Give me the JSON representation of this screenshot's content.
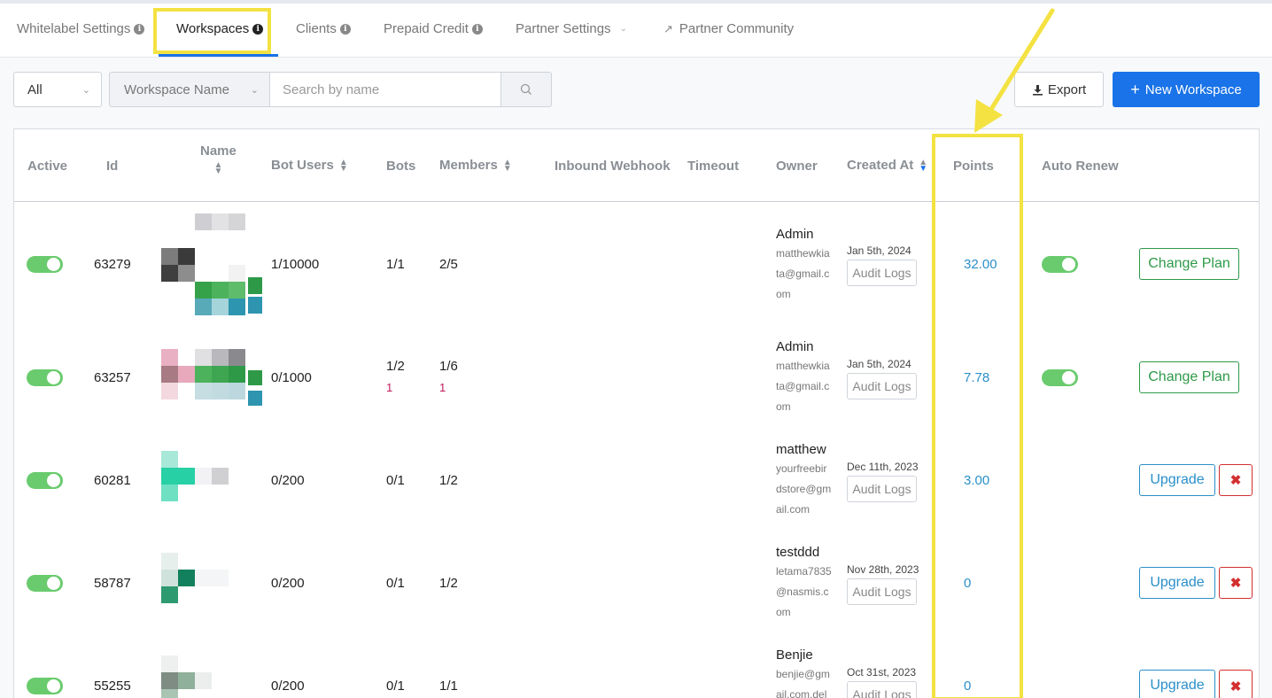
{
  "tabs": [
    {
      "label": "Whitelabel Settings",
      "info": true
    },
    {
      "label": "Workspaces",
      "info": true
    },
    {
      "label": "Clients",
      "info": true
    },
    {
      "label": "Prepaid Credit",
      "info": true
    },
    {
      "label": "Partner Settings",
      "dropdown": true
    },
    {
      "label": "Partner Community",
      "external": true
    }
  ],
  "filters": {
    "status": "All",
    "field": "Workspace Name",
    "search_placeholder": "Search by name"
  },
  "actions": {
    "export_label": "Export",
    "new_label": "New Workspace"
  },
  "columns": {
    "active": "Active",
    "id": "Id",
    "name": "Name",
    "bot_users": "Bot Users",
    "bots": "Bots",
    "members": "Members",
    "inbound": "Inbound Webhook",
    "timeout": "Timeout",
    "owner": "Owner",
    "created_at": "Created At",
    "points": "Points",
    "auto_renew": "Auto Renew"
  },
  "rows": [
    {
      "active": true,
      "id": "63279",
      "bot_users": "1/10000",
      "bots": "1/1",
      "bots_sub": "",
      "members": "2/5",
      "members_sub": "",
      "owner_name": "Admin",
      "owner_email": "matthewkiata@gmail.com",
      "created": "Jan 5th, 2024",
      "audit": "Audit Logs",
      "points": "32.00",
      "auto_renew": true,
      "action": "Change Plan"
    },
    {
      "active": true,
      "id": "63257",
      "bot_users": "0/1000",
      "bots": "1/2",
      "bots_sub": "1",
      "members": "1/6",
      "members_sub": "1",
      "owner_name": "Admin",
      "owner_email": "matthewkiata@gmail.com",
      "created": "Jan 5th, 2024",
      "audit": "Audit Logs",
      "points": "7.78",
      "auto_renew": true,
      "action": "Change Plan"
    },
    {
      "active": true,
      "id": "60281",
      "bot_users": "0/200",
      "bots": "0/1",
      "bots_sub": "",
      "members": "1/2",
      "members_sub": "",
      "owner_name": "matthew",
      "owner_email": "yourfreebirdstore@gmail.com",
      "created": "Dec 11th, 2023",
      "audit": "Audit Logs",
      "points": "3.00",
      "auto_renew": false,
      "action": "Upgrade"
    },
    {
      "active": true,
      "id": "58787",
      "bot_users": "0/200",
      "bots": "0/1",
      "bots_sub": "",
      "members": "1/2",
      "members_sub": "",
      "owner_name": "testddd",
      "owner_email": "letama7835@nasmis.com",
      "created": "Nov 28th, 2023",
      "audit": "Audit Logs",
      "points": "0",
      "auto_renew": false,
      "action": "Upgrade"
    },
    {
      "active": true,
      "id": "55255",
      "bot_users": "0/200",
      "bots": "0/1",
      "bots_sub": "",
      "members": "1/1",
      "members_sub": "",
      "owner_name": "Benjie",
      "owner_email": "benjie@gmail.com.del",
      "created": "Oct 31st, 2023",
      "audit": "Audit Logs",
      "points": "0",
      "auto_renew": false,
      "action": "Upgrade"
    }
  ],
  "colors": {
    "accent": "#1a73e8",
    "toggle_on": "#6acb6e",
    "points": "#2a8fc9",
    "change_plan": "#2e9a48",
    "delete": "#d32f2f",
    "highlight": "#f4e242"
  },
  "icons": [
    "info-icon",
    "chevron-down-icon",
    "external-link-icon",
    "search-icon",
    "download-icon",
    "plus-icon",
    "sort-icon",
    "close-icon"
  ]
}
